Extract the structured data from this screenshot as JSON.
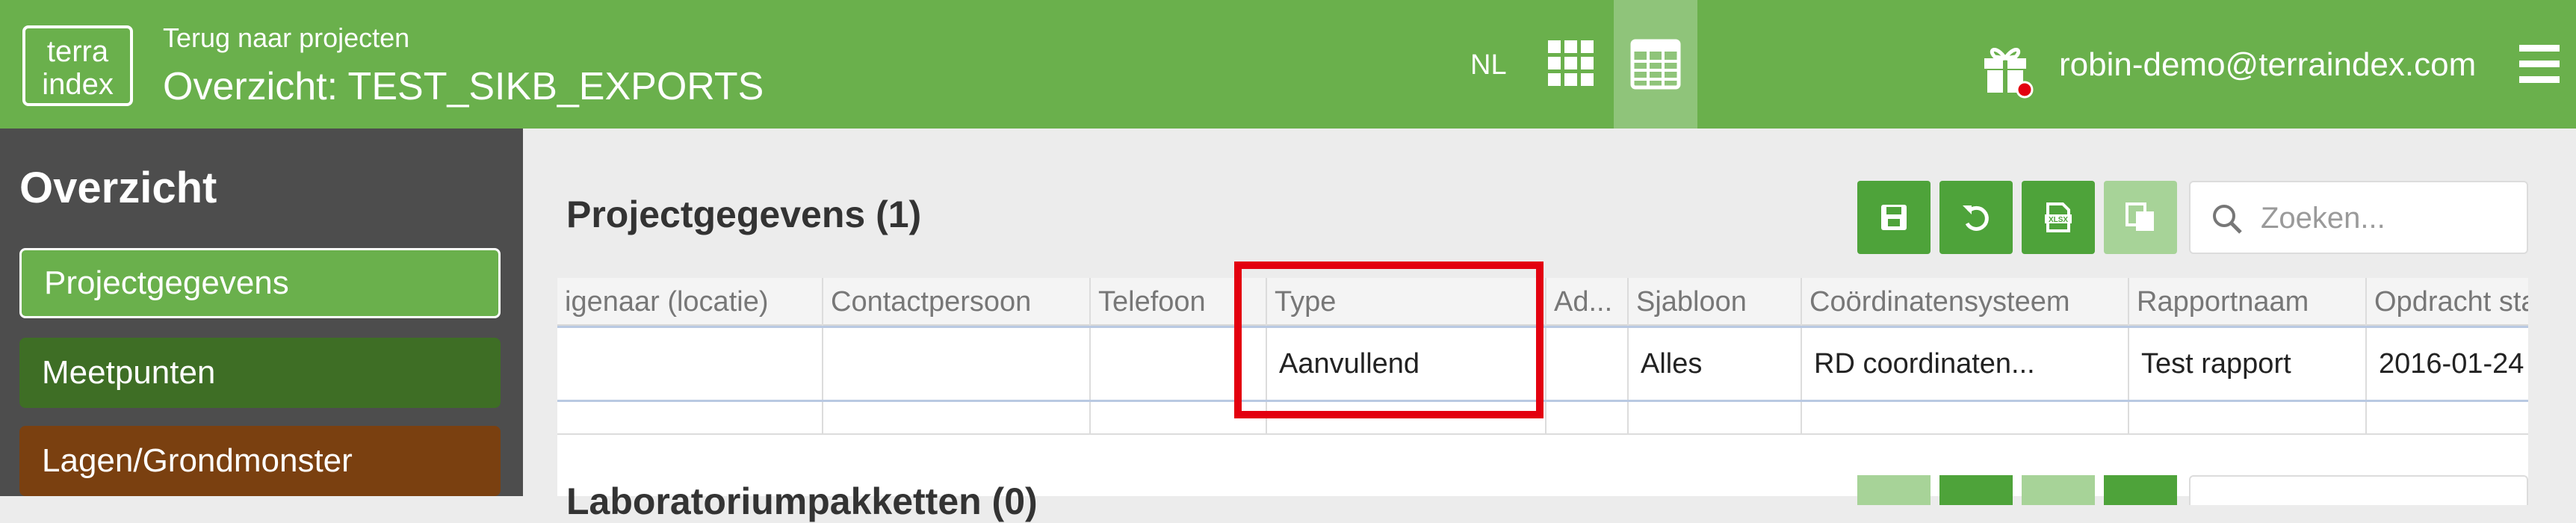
{
  "header": {
    "logo_line1": "terra",
    "logo_line2": "index",
    "back_link": "Terug naar projecten",
    "title": "Overzicht: TEST_SIKB_EXPORTS",
    "language": "NL",
    "user_email": "robin-demo@terraindex.com",
    "brand_color": "#6ab04c"
  },
  "sidebar": {
    "heading": "Overzicht",
    "items": [
      {
        "label": "Projectgegevens",
        "color": "#6ab04c"
      },
      {
        "label": "Meetpunten",
        "color": "#3e6e25"
      },
      {
        "label": "Lagen/Grondmonster",
        "color": "#7a4010"
      }
    ]
  },
  "main": {
    "section_title": "Projectgegevens (1)",
    "search_placeholder": "Zoeken...",
    "toolbar_icons": [
      "save-icon",
      "undo-icon",
      "xlsx-export-icon",
      "copy-icon"
    ],
    "table": {
      "columns": [
        "igenaar (locatie)",
        "Contactpersoon",
        "Telefoon",
        "Type",
        "Ad...",
        "Sjabloon",
        "Coördinatensysteem",
        "Rapportnaam",
        "Opdracht sta"
      ],
      "rows": [
        [
          "",
          "",
          "",
          "Aanvullend",
          "",
          "Alles",
          "RD coordinaten...",
          "Test rapport",
          "2016-01-24"
        ]
      ]
    },
    "next_section_title": "Laboratoriumpakketten (0)"
  }
}
